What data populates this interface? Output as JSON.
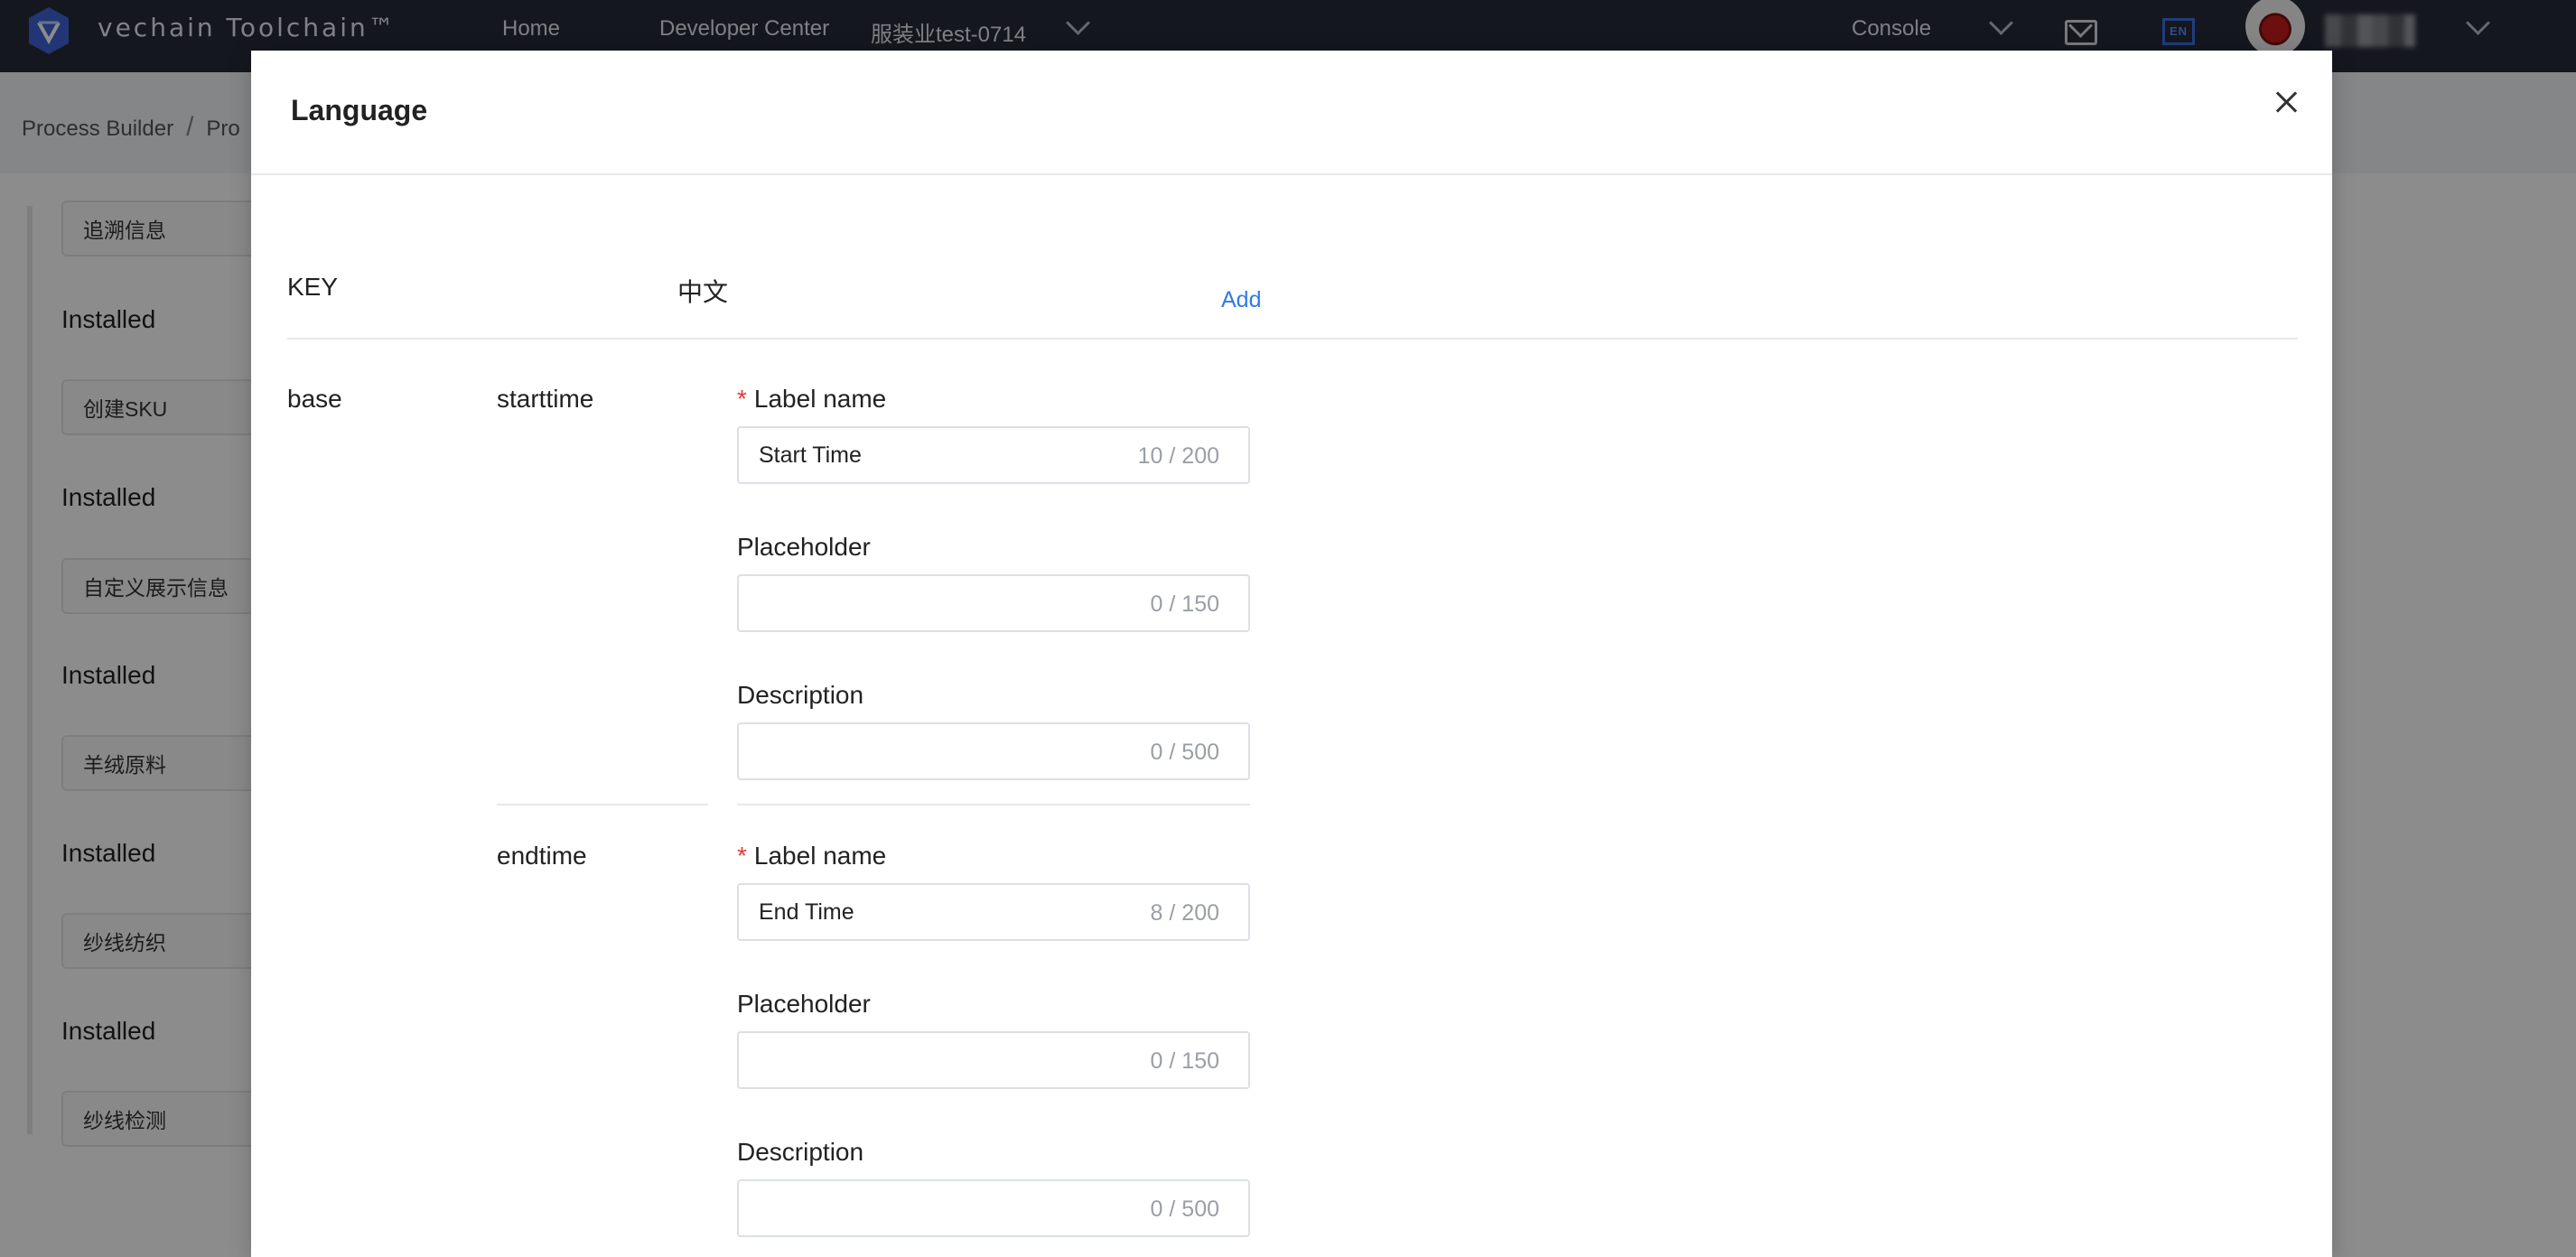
{
  "topbar": {
    "brand": "vechain Toolchain™",
    "nav": {
      "home": "Home",
      "developer_center": "Developer Center",
      "project": "服装业test-0714",
      "console": "Console"
    },
    "language_badge": "EN"
  },
  "background": {
    "breadcrumb": [
      "Process Builder",
      "Pro"
    ],
    "steps": [
      "追溯信息",
      "创建SKU",
      "自定义展示信息",
      "羊绒原料",
      "纱线纺织",
      "纱线检测"
    ],
    "installed_label": "Installed"
  },
  "modal": {
    "title": "Language",
    "columns": {
      "key": "KEY",
      "lang": "中文"
    },
    "add_label": "Add",
    "group_key": "base",
    "entries": [
      {
        "key": "starttime",
        "fields": [
          {
            "label": "Label name",
            "required": true,
            "value": "Start Time",
            "count": "10 / 200"
          },
          {
            "label": "Placeholder",
            "required": false,
            "value": "",
            "count": "0 / 150"
          },
          {
            "label": "Description",
            "required": false,
            "value": "",
            "count": "0 / 500"
          }
        ]
      },
      {
        "key": "endtime",
        "fields": [
          {
            "label": "Label name",
            "required": true,
            "value": "End Time",
            "count": "8 / 200"
          },
          {
            "label": "Placeholder",
            "required": false,
            "value": "",
            "count": "0 / 150"
          },
          {
            "label": "Description",
            "required": false,
            "value": "",
            "count": "0 / 500"
          }
        ]
      }
    ],
    "required_mark": "*"
  },
  "icons": [
    "vechain-logo-icon",
    "chevron-down-icon",
    "mail-icon",
    "language-icon",
    "avatar",
    "close-icon"
  ],
  "colors": {
    "topbar": "#262b36",
    "accent_link": "#2f7be6",
    "required": "#e53935",
    "language_badge": "#3d6fe6"
  }
}
